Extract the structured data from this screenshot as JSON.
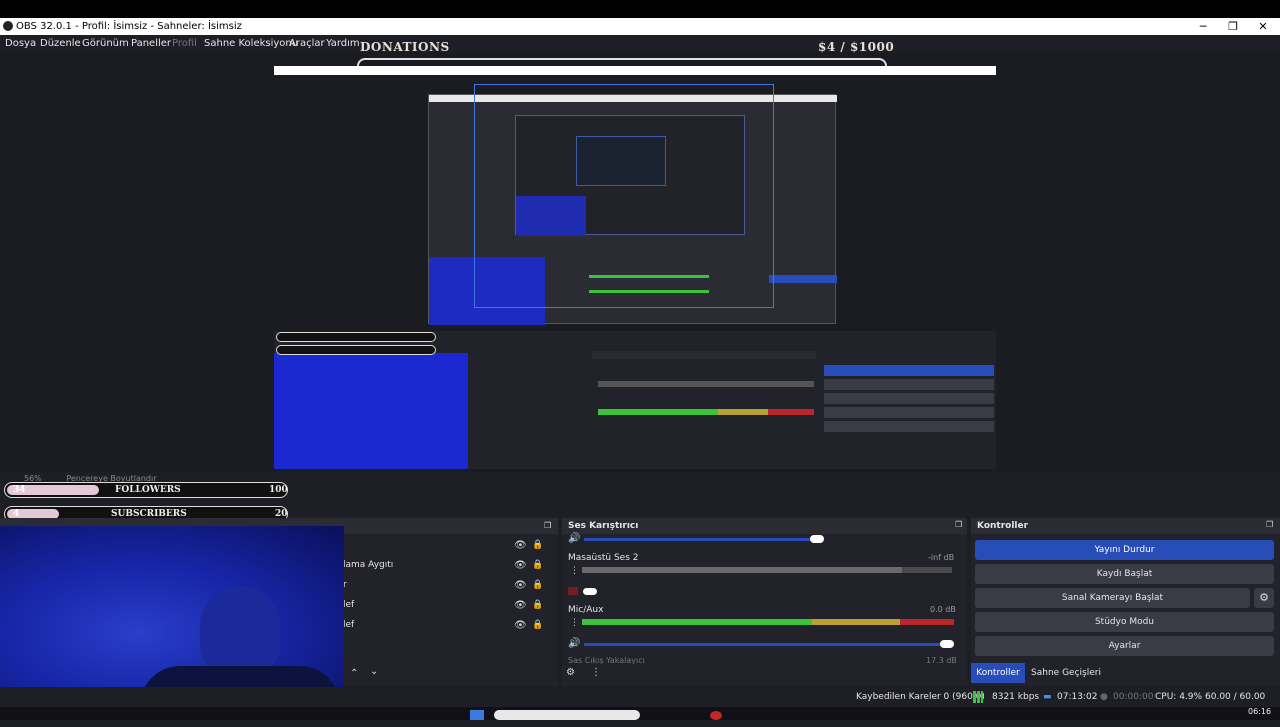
{
  "window": {
    "title": "OBS 32.0.1 - Profil: İsimsiz - Sahneler: İsimsiz",
    "minimize": "─",
    "maximize": "❐",
    "close": "✕"
  },
  "menu": [
    "Dosya",
    "Düzenle",
    "Görünüm",
    "Paneller",
    "Profil",
    "Sahne Koleksiyonu",
    "Araçlar",
    "Yardım"
  ],
  "overlay": {
    "donations_label": "DONATIONS",
    "donations_value": "$4   / $1000",
    "followers": {
      "count": "34",
      "label": "FOLLOWERS",
      "goal": "100"
    },
    "subscribers": {
      "count": "4",
      "label": "SUBSCRIBERS",
      "goal": "20"
    }
  },
  "preview_bar": {
    "zoom": "56%",
    "mode": "Pencereye Boyutlandır"
  },
  "sources": {
    "items": [
      "lama Aygıtı",
      "r",
      "lef",
      "lef",
      ""
    ]
  },
  "mixer": {
    "title": "Ses Karıştırıcı",
    "channels": [
      {
        "name": "Masaüstü Ses 2",
        "db": "-inf dB"
      },
      {
        "name": "Mic/Aux",
        "db": "0.0 dB"
      }
    ],
    "scale": [
      "-60",
      "-55",
      "-50",
      "-45",
      "-40",
      "-35",
      "-30",
      "-25",
      "-20",
      "-15",
      "-10",
      "-5",
      "0"
    ],
    "next_channel": "Sas Cıkış Yakalayıcı",
    "next_db": "17.3 dB"
  },
  "controls": {
    "title": "Kontroller",
    "buttons": [
      "Yayını Durdur",
      "Kaydı Başlat",
      "Sanal Kamerayı Başlat",
      "Stüdyo Modu",
      "Ayarlar"
    ],
    "tabs": [
      "Kontroller",
      "Sahne Geçişleri"
    ]
  },
  "status": {
    "dropped": "Kaybedilen Kareler 0 (960.0)",
    "bitrate": "8321 kbps",
    "stream_time": "07:13:02",
    "rec_time": "00:00:00",
    "cpu": "CPU: 4.9%",
    "fps": "60.00 / 60.00 FPS"
  },
  "taskbar": {
    "clock": "06:16"
  },
  "colors": {
    "accent": "#284cb8",
    "meter_green": "#3bc43b",
    "meter_yellow": "#b9a233",
    "meter_red": "#b9262c"
  }
}
